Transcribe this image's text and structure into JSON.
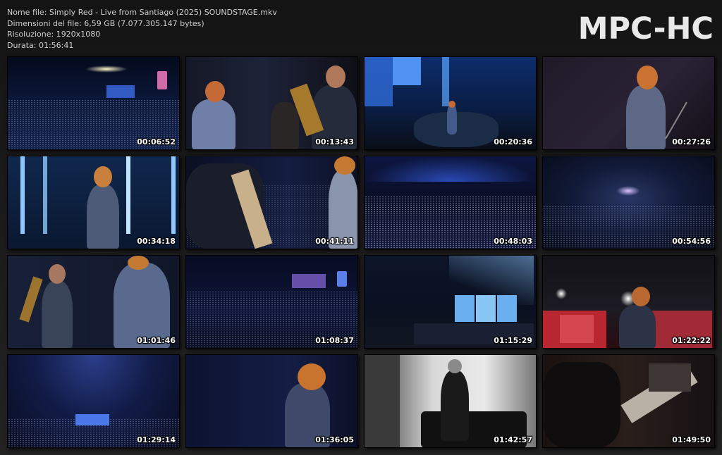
{
  "header": {
    "file_name": "Nome file: Simply Red - Live from Santiago (2025) SOUNDSTAGE.mkv",
    "file_size": "Dimensioni del file: 6,59 GB (7.077.305.147 bytes)",
    "resolution": "Risoluzione: 1920x1080",
    "duration": "Durata: 01:56:41"
  },
  "logo": "MPC-HC",
  "thumbnails": [
    {
      "timestamp": "00:06:52",
      "scene": "arena-wide-blue"
    },
    {
      "timestamp": "00:13:43",
      "scene": "singer-and-saxophonist"
    },
    {
      "timestamp": "00:20:36",
      "scene": "stage-video-wall"
    },
    {
      "timestamp": "00:27:26",
      "scene": "singer-red-mic"
    },
    {
      "timestamp": "00:34:18",
      "scene": "singer-light-columns"
    },
    {
      "timestamp": "00:41:11",
      "scene": "guitarist-closeup"
    },
    {
      "timestamp": "00:48:03",
      "scene": "crowd-dome"
    },
    {
      "timestamp": "00:54:56",
      "scene": "dome-top-view"
    },
    {
      "timestamp": "01:01:46",
      "scene": "sax-and-singer"
    },
    {
      "timestamp": "01:08:37",
      "scene": "arena-stage-distance"
    },
    {
      "timestamp": "01:15:29",
      "scene": "stage-screens-sky"
    },
    {
      "timestamp": "01:22:22",
      "scene": "singer-red-screen"
    },
    {
      "timestamp": "01:29:14",
      "scene": "arena-stage-lights"
    },
    {
      "timestamp": "01:36:05",
      "scene": "singer-mic-blue"
    },
    {
      "timestamp": "01:42:57",
      "scene": "bw-room-figure"
    },
    {
      "timestamp": "01:49:50",
      "scene": "guitar-closeup"
    }
  ]
}
